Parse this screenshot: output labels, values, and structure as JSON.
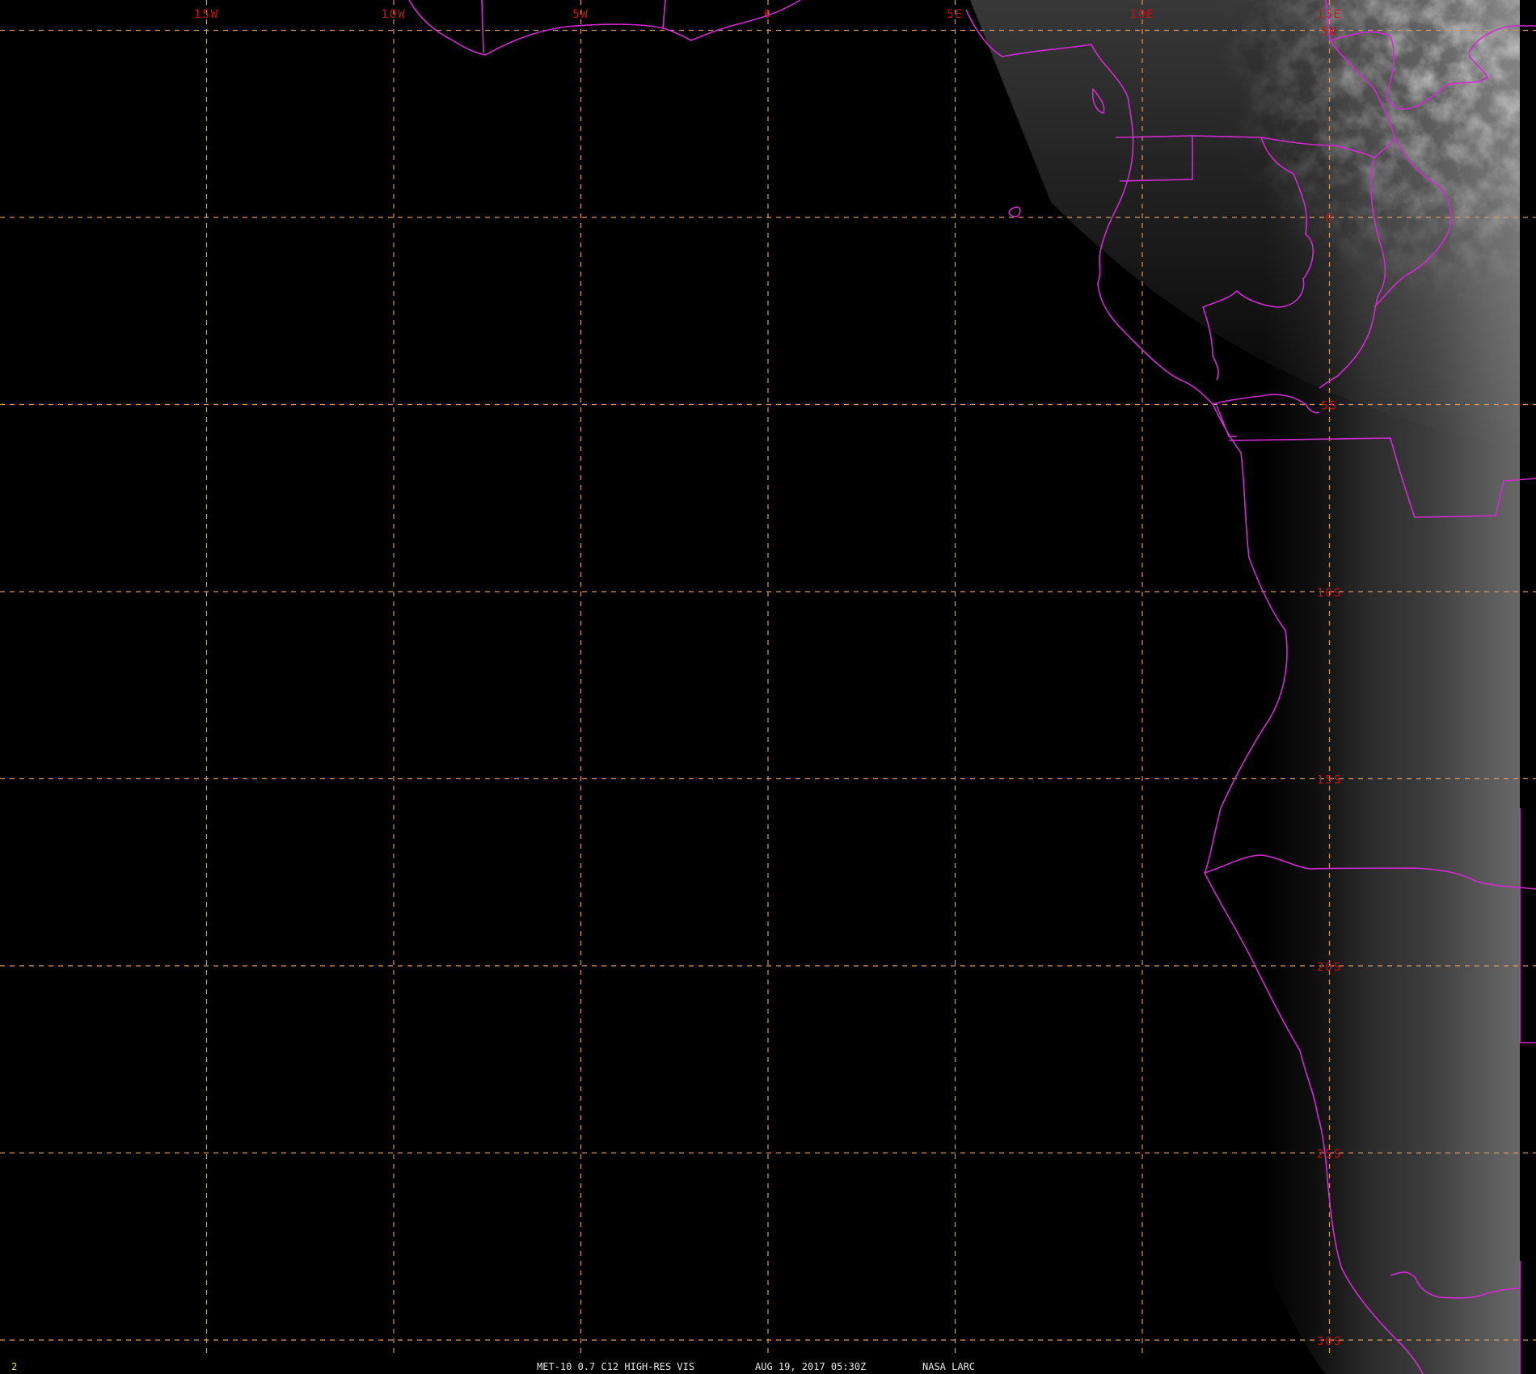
{
  "colors": {
    "background": "#000000",
    "grid": "#d89a5c",
    "grid_label": "#cc1010",
    "borders": "#d22ad2",
    "caption": "#e6e6e6",
    "frame_number": "#e8e820"
  },
  "grid": {
    "longitudes": [
      {
        "lon": -15,
        "label": "15W"
      },
      {
        "lon": -10,
        "label": "10W"
      },
      {
        "lon": -5,
        "label": "5W"
      },
      {
        "lon": 0,
        "label": "0"
      },
      {
        "lon": 5,
        "label": "5E"
      },
      {
        "lon": 10,
        "label": "10E"
      },
      {
        "lon": 15,
        "label": "15E"
      }
    ],
    "latitudes": [
      {
        "lat": 5,
        "label": "5N"
      },
      {
        "lat": 0,
        "label": "0"
      },
      {
        "lat": -5,
        "label": "5S"
      },
      {
        "lat": -10,
        "label": "10S"
      },
      {
        "lat": -15,
        "label": "15S"
      },
      {
        "lat": -20,
        "label": "20S"
      },
      {
        "lat": -25,
        "label": "25S"
      },
      {
        "lat": -30,
        "label": "30S"
      }
    ]
  },
  "caption": {
    "frame": "2",
    "product": "MET-10 0.7 C12 HIGH-RES VIS",
    "time": "AUG 19, 2017 05:30Z",
    "source": "NASA LARC"
  }
}
